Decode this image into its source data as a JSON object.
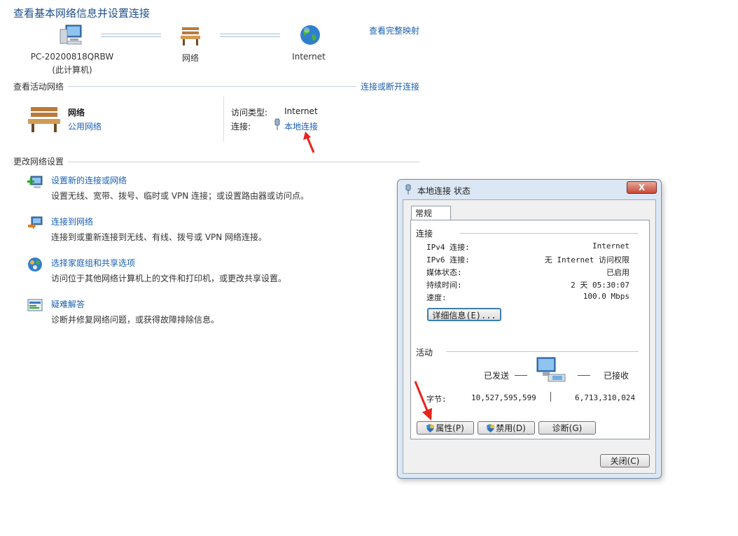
{
  "page": {
    "title": "查看基本网络信息并设置连接",
    "see_full_map": "查看完整映射",
    "map": {
      "pc_name": "PC-20200818QRBW",
      "pc_sub": "(此计算机)",
      "network": "网络",
      "internet": "Internet"
    },
    "active_section": {
      "title": "查看活动网络",
      "connect_link": "连接或断开连接",
      "network_name": "网络",
      "network_type": "公用网络",
      "access_type_label": "访问类型:",
      "access_type_value": "Internet",
      "connection_label": "连接:",
      "connection_value": "本地连接"
    },
    "change_section": {
      "title": "更改网络设置",
      "tasks": [
        {
          "title": "设置新的连接或网络",
          "desc": "设置无线、宽带、拨号、临时或 VPN 连接；或设置路由器或访问点。"
        },
        {
          "title": "连接到网络",
          "desc": "连接到或重新连接到无线、有线、拨号或 VPN 网络连接。"
        },
        {
          "title": "选择家庭组和共享选项",
          "desc": "访问位于其他网络计算机上的文件和打印机，或更改共享设置。"
        },
        {
          "title": "疑难解答",
          "desc": "诊断并修复网络问题，或获得故障排除信息。"
        }
      ]
    }
  },
  "dialog": {
    "title": "本地连接 状态",
    "close_glyph": "X",
    "tab": "常规",
    "connection_group": "连接",
    "rows": [
      {
        "label": "IPv4 连接:",
        "value": "Internet"
      },
      {
        "label": "IPv6 连接:",
        "value": "无 Internet 访问权限"
      },
      {
        "label": "媒体状态:",
        "value": "已启用"
      },
      {
        "label": "持续时间:",
        "value": "2 天 05:30:07"
      },
      {
        "label": "速度:",
        "value": "100.0 Mbps"
      }
    ],
    "details_button": "详细信息(E)...",
    "activity_group": "活动",
    "sent_label": "已发送",
    "received_label": "已接收",
    "bytes_label": "字节:",
    "bytes_sent": "10,527,595,599",
    "bytes_received": "6,713,310,024",
    "properties_button": "属性(P)",
    "disable_button": "禁用(D)",
    "diagnose_button": "诊断(G)",
    "close_button": "关闭(C)"
  },
  "colors": {
    "link": "#1a5fb4",
    "annotation_arrow": "#e8241c"
  }
}
